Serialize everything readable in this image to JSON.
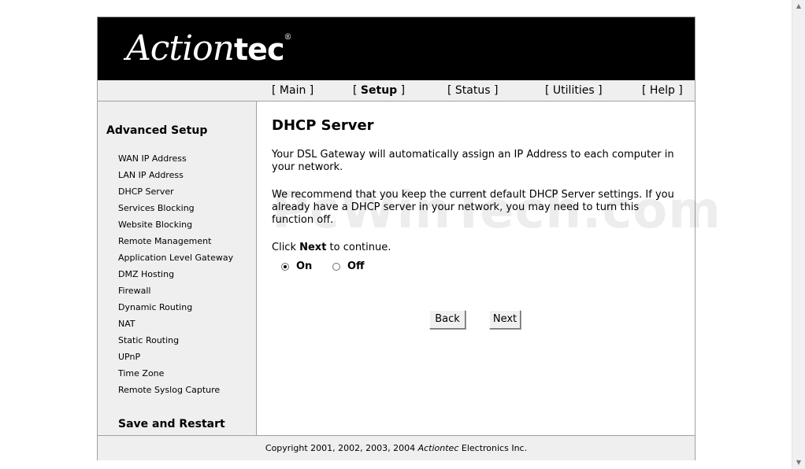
{
  "header": {
    "logo_main": "Action",
    "logo_tec": "tec",
    "logo_reg": "®"
  },
  "nav": {
    "items": [
      {
        "pre": "[ ",
        "label": "Main",
        "post": " ]"
      },
      {
        "pre": "[ ",
        "label": "Setup",
        "post": " ]"
      },
      {
        "pre": "[ ",
        "label": "Status",
        "post": " ]"
      },
      {
        "pre": "[ ",
        "label": "Utilities",
        "post": " ]"
      },
      {
        "pre": "[ ",
        "label": "Help",
        "post": " ]"
      }
    ],
    "active": "Setup"
  },
  "sidebar": {
    "title": "Advanced Setup",
    "items": [
      "WAN IP Address",
      "LAN IP Address",
      "DHCP Server",
      "Services Blocking",
      "Website Blocking",
      "Remote Management",
      "Application Level Gateway",
      "DMZ Hosting",
      "Firewall",
      "Dynamic Routing",
      "NAT",
      "Static Routing",
      "UPnP",
      "Time Zone",
      "Remote Syslog Capture"
    ],
    "save": "Save and Restart"
  },
  "main": {
    "title": "DHCP Server",
    "para1": "Your DSL Gateway will automatically assign an IP Address to each computer in your network.",
    "para2": "We recommend that you keep the current default DHCP Server settings. If you already have a DHCP server in your network, you may need to turn this function off.",
    "click_pre": "Click ",
    "click_bold": "Next",
    "click_post": " to continue.",
    "radio_on": "On",
    "radio_off": "Off",
    "selected": "On",
    "back_label": "Back",
    "next_label": "Next"
  },
  "watermark": "PcWinTech.com",
  "footer": {
    "pre": "Copyright 2001, 2002, 2003, 2004 ",
    "brand": "Actiontec",
    "post": " Electronics Inc."
  },
  "scrollbar": {
    "up": "▲",
    "down": "▼"
  }
}
